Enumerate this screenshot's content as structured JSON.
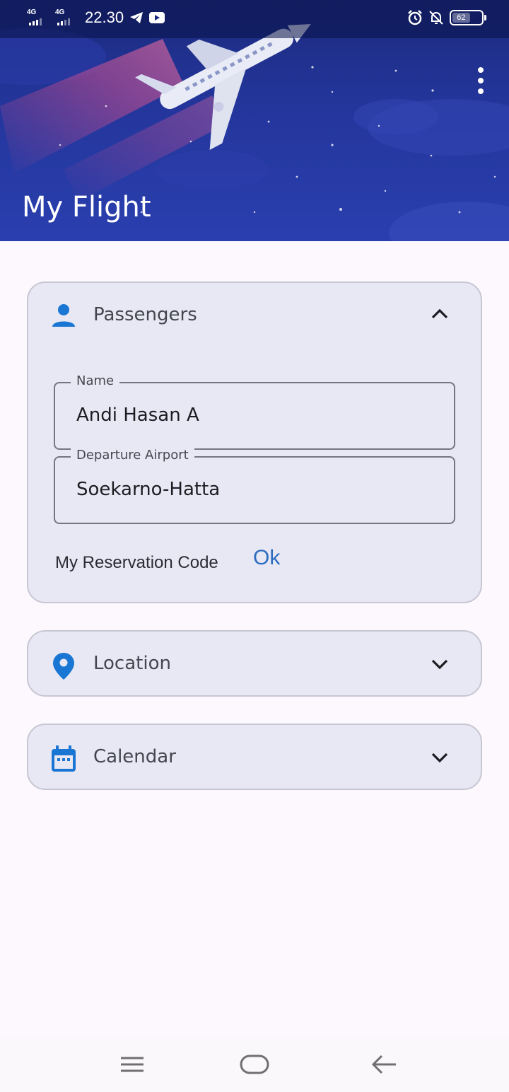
{
  "status_bar": {
    "network_1": "4G",
    "network_2": "4G",
    "time": "22.30",
    "battery": "62"
  },
  "header": {
    "title": "My Flight",
    "more_icon": "more-vert-icon"
  },
  "passengers_card": {
    "icon": "person-icon",
    "title": "Passengers",
    "expanded": true,
    "name_field": {
      "label": "Name",
      "value": "Andi Hasan A"
    },
    "airport_field": {
      "label": "Departure Airport",
      "value": "Soekarno-Hatta"
    },
    "reservation_label": "My Reservation Code",
    "ok_label": "Ok"
  },
  "location_card": {
    "icon": "location-pin-icon",
    "title": "Location",
    "expanded": false
  },
  "calendar_card": {
    "icon": "calendar-icon",
    "title": "Calendar",
    "expanded": false
  },
  "colors": {
    "accent": "#1976d2",
    "banner": "#24369c",
    "card_bg": "#e8e8f4",
    "ok_text": "#2b6cc0"
  },
  "nav_bar": {
    "menu_icon": "menu-icon",
    "home_icon": "home-pill-icon",
    "back_icon": "back-arrow-icon"
  }
}
